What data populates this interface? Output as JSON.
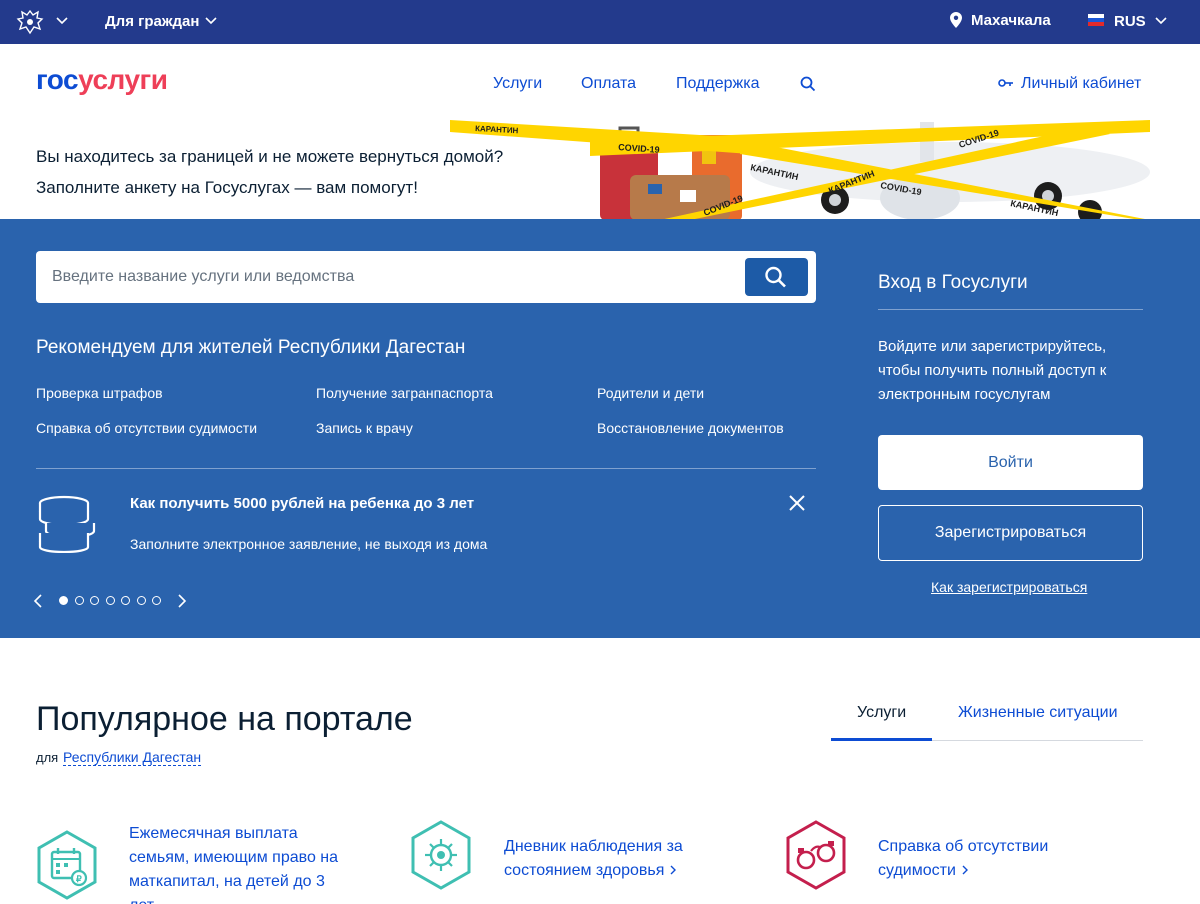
{
  "topbar": {
    "citizens_label": "Для граждан",
    "city": "Махачкала",
    "language": "RUS"
  },
  "header": {
    "logo_part1": "гос",
    "logo_part2": "услуги",
    "nav": [
      "Услуги",
      "Оплата",
      "Поддержка"
    ],
    "cabinet": "Личный кабинет"
  },
  "banner": {
    "line1": "Вы находитесь за границей и не можете вернуться домой?",
    "line2": "Заполните анкету на Госуслугах — вам помогут!",
    "tape_covid": "COVID-19",
    "tape_quarantine": "КАРАНТИН"
  },
  "search": {
    "placeholder": "Введите название услуги или ведомства"
  },
  "recommend": {
    "title": "Рекомендуем для жителей Республики Дагестан",
    "links": [
      "Проверка штрафов",
      "Получение загранпаспорта",
      "Родители и дети",
      "Справка об отсутствии судимости",
      "Запись к врачу",
      "Восстановление документов"
    ]
  },
  "promo": {
    "title": "Как получить 5000 рублей на ребенка до 3 лет",
    "subtitle": "Заполните электронное заявление, не выходя из дома",
    "slides_total": 7,
    "active_slide": 1
  },
  "login": {
    "title": "Вход в Госуслуги",
    "description": "Войдите или зарегистрируйтесь, чтобы получить полный доступ к электронным госуслугам",
    "login_button": "Войти",
    "register_button": "Зарегистрироваться",
    "how_link": "Как зарегистрироваться"
  },
  "popular": {
    "title": "Популярное на портале",
    "for_label": "для",
    "region": "Республики Дагестан",
    "tabs": [
      "Услуги",
      "Жизненные ситуации"
    ],
    "services": [
      {
        "lines": [
          "Ежемесячная выплата",
          "семьям, имеющим право на",
          "маткапитал, на детей до 3",
          "лет"
        ],
        "icon": "calendar-ruble-icon"
      },
      {
        "lines": [
          "Дневник наблюдения за",
          "состоянием здоровья"
        ],
        "icon": "virus-icon"
      },
      {
        "lines": [
          "Справка об отсутствии",
          "судимости"
        ],
        "icon": "handcuffs-icon"
      }
    ]
  },
  "colors": {
    "topbar": "#233a8c",
    "hero": "#2a63ad",
    "link": "#0d4cd3",
    "logo_red": "#ee3f58",
    "teal": "#3fbfb2",
    "crimson": "#c41f4d"
  }
}
